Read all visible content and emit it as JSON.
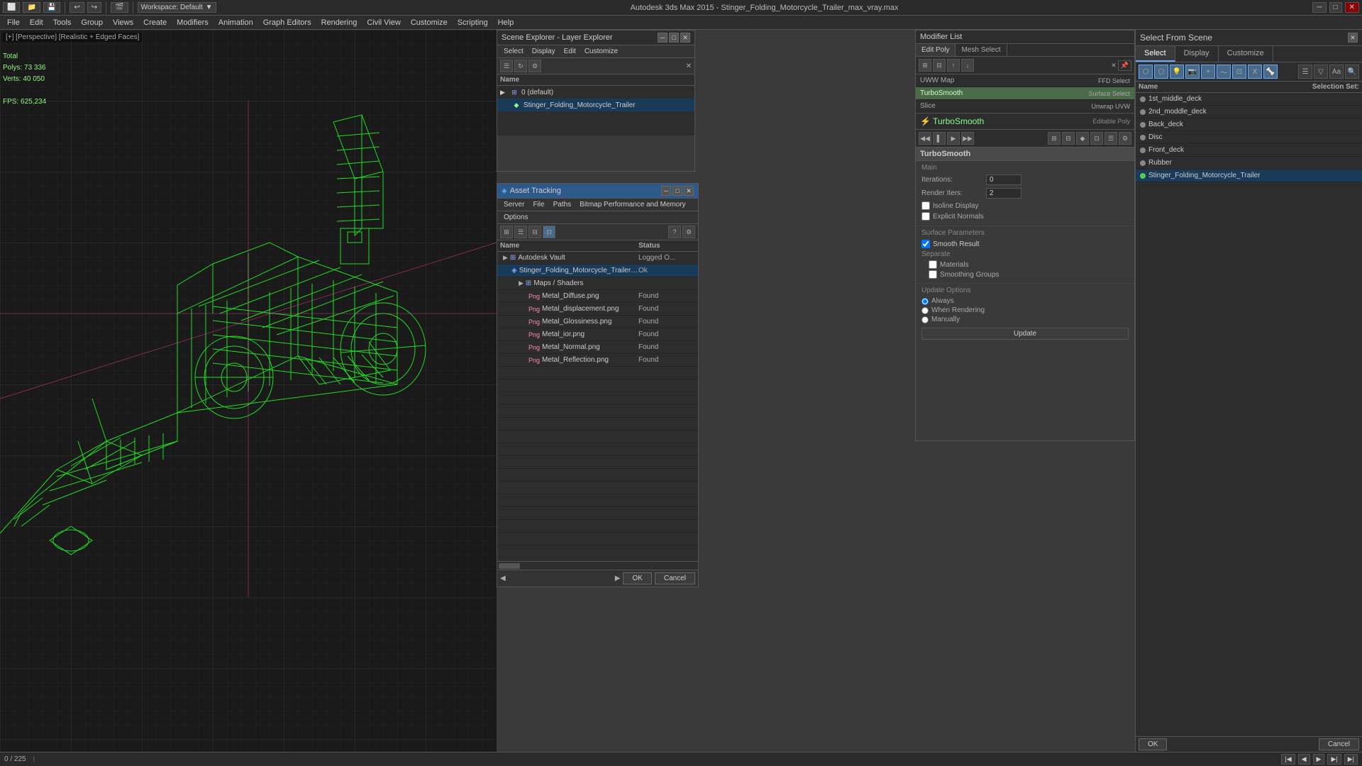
{
  "app": {
    "title": "Autodesk 3ds Max 2015",
    "file": "Stinger_Folding_Motorcycle_Trailer_max_vray.max",
    "window_title": "Autodesk 3ds Max 2015 - Stinger_Folding_Motorcycle_Trailer_max_vray.max"
  },
  "toolbar": {
    "workspace_label": "Workspace: Default"
  },
  "viewport": {
    "label": "[+] [Perspective] [Realistic + Edged Faces]",
    "stats_total": "Total",
    "stats_polys": "Polys:  73 336",
    "stats_verts": "Verts:  40 050",
    "fps_label": "FPS:",
    "fps_value": "625,234"
  },
  "scene_explorer": {
    "title": "Scene Explorer - Layer Explorer",
    "name_col": "Name",
    "layer_default": "0 (default)",
    "object_name": "Stinger_Folding_Motorcycle_Trailer"
  },
  "asset_tracking": {
    "title": "Asset Tracking",
    "menu_server": "Server",
    "menu_file": "File",
    "menu_paths": "Paths",
    "menu_bitmap": "Bitmap Performance and Memory",
    "menu_options": "Options",
    "col_name": "Name",
    "col_status": "Status",
    "rows": [
      {
        "name": "Autodesk Vault",
        "status": "Logged O...",
        "indent": 0,
        "type": "folder"
      },
      {
        "name": "Stinger_Folding_Motorcycle_Trailer_max_vra...",
        "status": "Ok",
        "indent": 1,
        "type": "file"
      },
      {
        "name": "Maps / Shaders",
        "status": "",
        "indent": 2,
        "type": "folder"
      },
      {
        "name": "Metal_Diffuse.png",
        "status": "Found",
        "indent": 3,
        "type": "image"
      },
      {
        "name": "Metal_displacement.png",
        "status": "Found",
        "indent": 3,
        "type": "image"
      },
      {
        "name": "Metal_Glossiness.png",
        "status": "Found",
        "indent": 3,
        "type": "image"
      },
      {
        "name": "Metal_ior.png",
        "status": "Found",
        "indent": 3,
        "type": "image"
      },
      {
        "name": "Metal_Normal.png",
        "status": "Found",
        "indent": 3,
        "type": "image"
      },
      {
        "name": "Metal_Reflection.png",
        "status": "Found",
        "indent": 3,
        "type": "image"
      }
    ],
    "btn_ok": "OK",
    "btn_cancel": "Cancel"
  },
  "select_from_scene": {
    "title": "Select From Scene",
    "tab_select": "Select",
    "tab_display": "Display",
    "tab_customize": "Customize",
    "name_col": "Name",
    "selection_set": "Selection Set:",
    "objects": [
      {
        "name": "1st_middle_deck",
        "color": "gray"
      },
      {
        "name": "2nd_moddle_deck",
        "color": "gray"
      },
      {
        "name": "Back_deck",
        "color": "gray"
      },
      {
        "name": "Disc",
        "color": "gray"
      },
      {
        "name": "Front_deck",
        "color": "gray"
      },
      {
        "name": "Rubber",
        "color": "gray"
      },
      {
        "name": "Stinger_Folding_Motorcycle_Trailer",
        "color": "green"
      }
    ],
    "btn_ok": "OK",
    "btn_cancel": "Cancel"
  },
  "modifier_panel": {
    "title": "Modifier List",
    "tab_edit_poly": "Edit Poly",
    "tab_mesh_select": "Mesh Select",
    "modifiers": [
      {
        "name": "UWW Map",
        "extra": "FFD Select"
      },
      {
        "name": "TurboSmooth",
        "extra": "Surface Select"
      },
      {
        "name": "Slice",
        "extra": "Unwrap UVW"
      }
    ],
    "modifier_name": "TurboSmooth",
    "editable_poly": "Editable Poly",
    "turbosmooth_section": {
      "title": "TurboSmooth",
      "main_label": "Main",
      "iterations_label": "Iterations:",
      "iterations_value": "0",
      "render_iters_label": "Render Iters:",
      "render_iters_value": "2",
      "isoline_display": "Isoline Display",
      "explicit_normals": "Explicit Normals",
      "surface_params": "Surface Parameters",
      "smooth_result": "Smooth Result",
      "separate_label": "Separate",
      "materials": "Materials",
      "smoothing_groups": "Smoothing Groups",
      "update_options": "Update Options",
      "always": "Always",
      "when_rendering": "When Rendering",
      "manually": "Manually",
      "update_btn": "Update"
    }
  },
  "status_bar": {
    "progress": "0 / 225"
  }
}
